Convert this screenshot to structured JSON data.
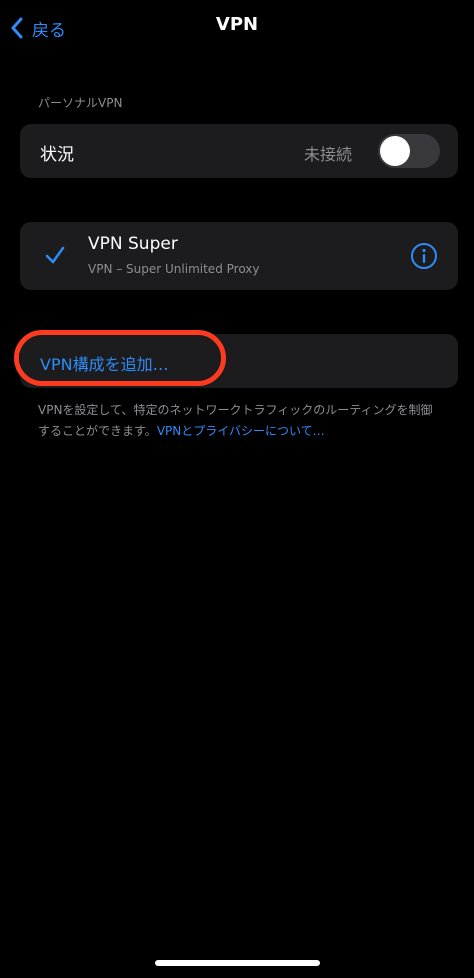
{
  "nav": {
    "back_label": "戻る",
    "title": "VPN"
  },
  "personal_vpn": {
    "section_header": "パーソナルVPN",
    "status_label": "状況",
    "status_value": "未接続",
    "toggle_on": false
  },
  "vpn_config": {
    "name": "VPN Super",
    "subtitle": "VPN – Super Unlimited Proxy",
    "selected": true
  },
  "add_config": {
    "label": "VPN構成を追加…"
  },
  "footer": {
    "note": "VPNを設定して、特定のネットワークトラフィックのルーティングを制御することができます。",
    "link": "VPNとプライバシーについて…"
  },
  "colors": {
    "accent": "#2f8bf5",
    "highlight": "#ff3b1f",
    "card": "#1c1c1e"
  },
  "icons": {
    "back": "chevron-left-icon",
    "check": "checkmark-icon",
    "info": "info-circle-icon"
  }
}
